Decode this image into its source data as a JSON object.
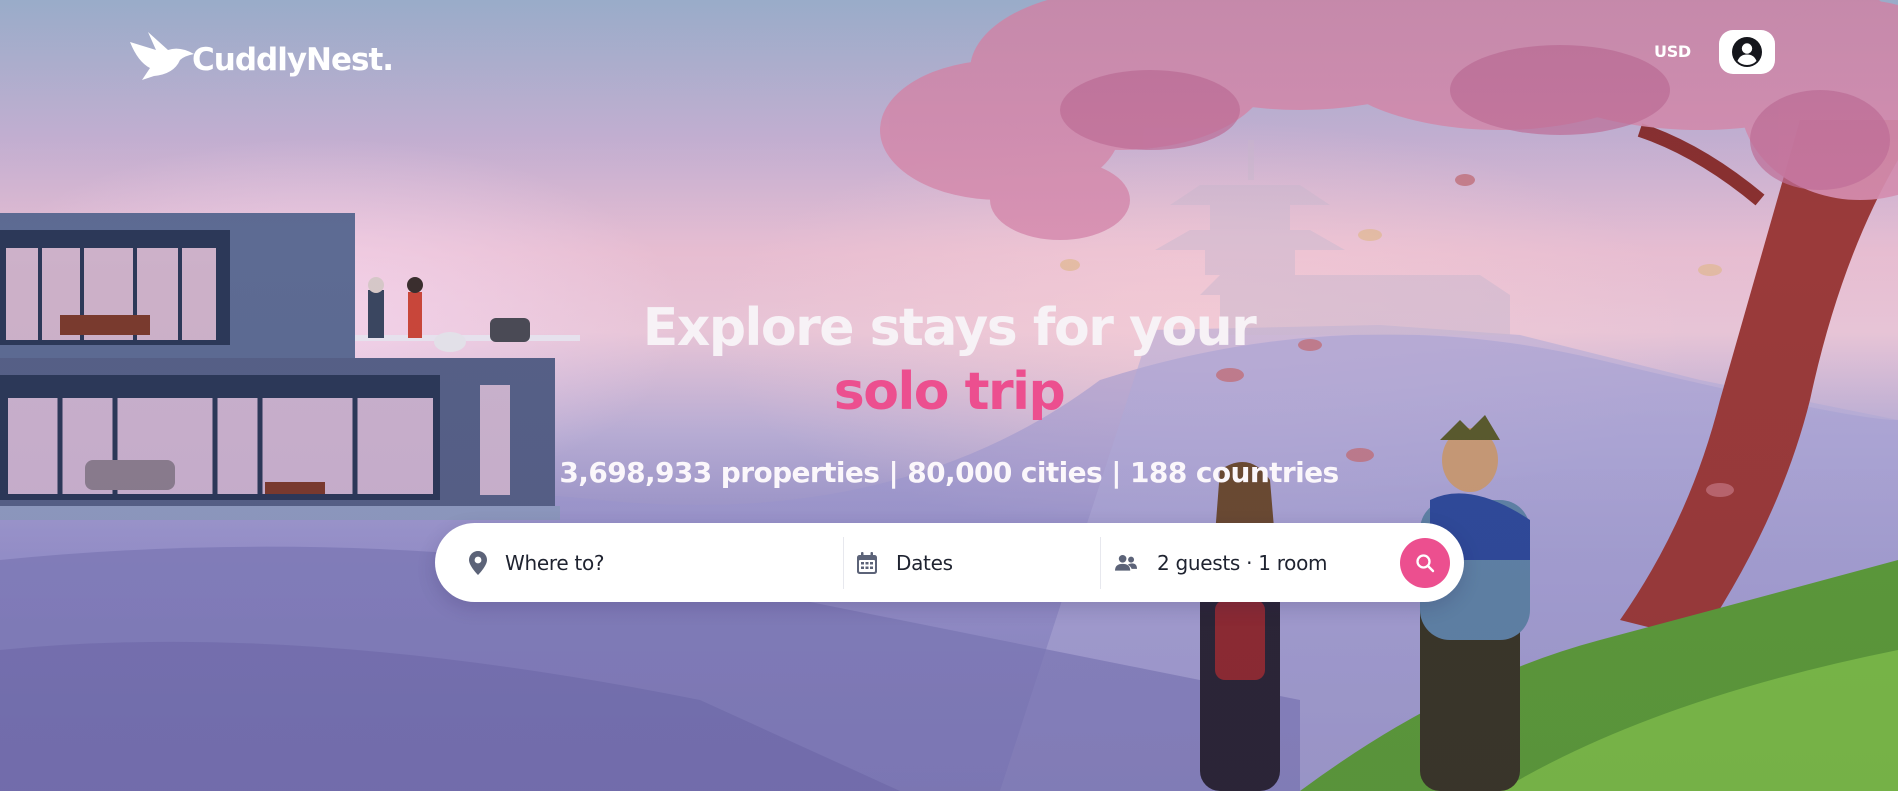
{
  "brand": {
    "name": "CuddlyNest.",
    "logo_icon": "hummingbird-logo-icon"
  },
  "header": {
    "currency": "USD",
    "account_icon": "user-circle-icon"
  },
  "hero": {
    "title_line1": "Explore stays for your",
    "title_line2": "solo trip",
    "stats": "3,698,933 properties | 80,000 cities | 188 countries"
  },
  "search": {
    "where_label": "Where to?",
    "where_icon": "map-pin-icon",
    "dates_label": "Dates",
    "dates_icon": "calendar-icon",
    "guests_label": "2 guests · 1 room",
    "guests_icon": "users-icon",
    "submit_icon": "search-icon"
  },
  "colors": {
    "accent": "#ec4f8f",
    "text_dark": "#1f2330",
    "icon_gray": "#5c6378"
  }
}
